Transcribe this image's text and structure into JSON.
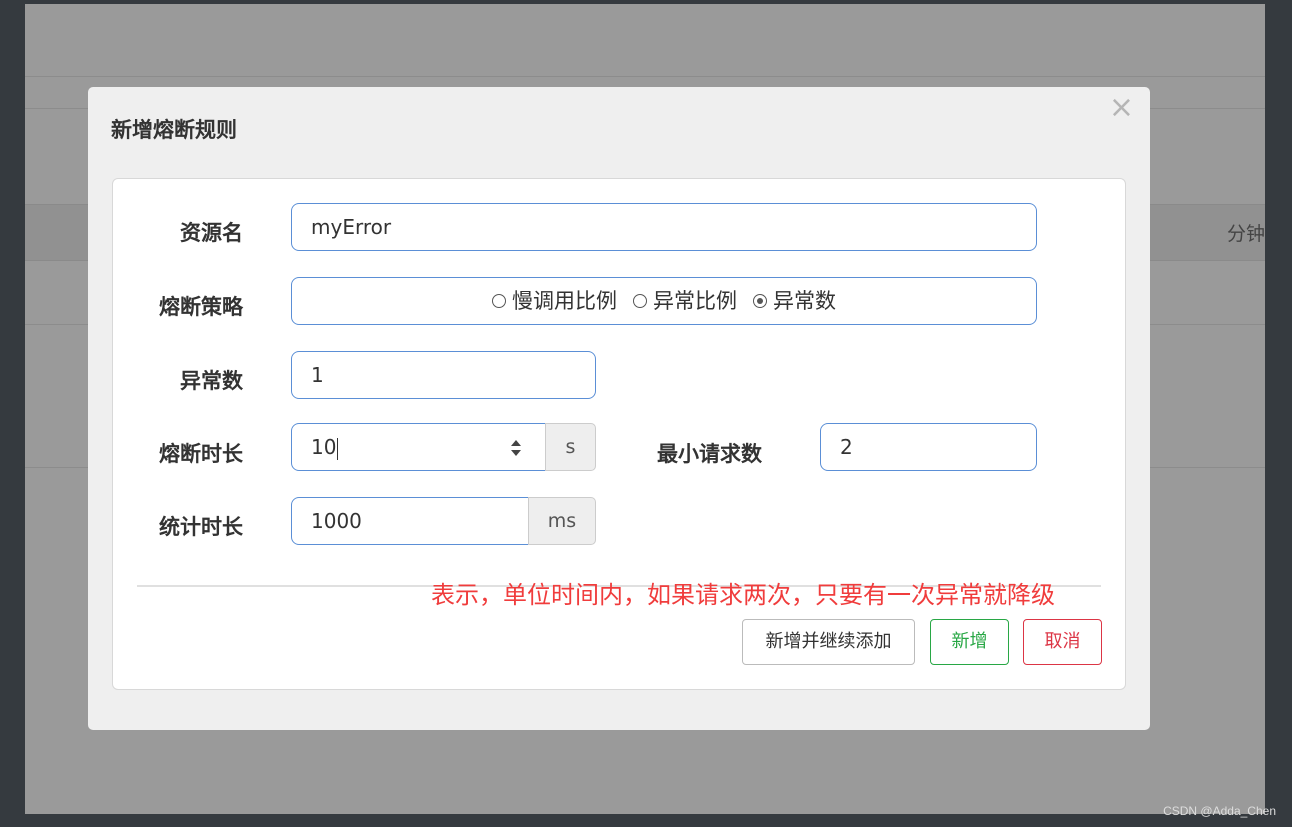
{
  "modal": {
    "title": "新增熔断规则",
    "close_glyph": "×"
  },
  "form": {
    "resource_label": "资源名",
    "resource_value": "myError",
    "strategy_label": "熔断策略",
    "strategy_options": [
      {
        "label": "慢调用比例",
        "selected": false
      },
      {
        "label": "异常比例",
        "selected": false
      },
      {
        "label": "异常数",
        "selected": true
      }
    ],
    "exception_count_label": "异常数",
    "exception_count_value": "1",
    "break_duration_label": "熔断时长",
    "break_duration_value": "10",
    "break_duration_unit": "s",
    "min_request_label": "最小请求数",
    "min_request_value": "2",
    "stat_duration_label": "统计时长",
    "stat_duration_value": "1000",
    "stat_duration_unit": "ms"
  },
  "annotation": "表示，单位时间内，如果请求两次，只要有一次异常就降级",
  "buttons": {
    "add_continue": "新增并继续添加",
    "add": "新增",
    "cancel": "取消"
  },
  "background": {
    "partial_text": "分钟"
  },
  "watermark": "CSDN @Adda_Chen",
  "colors": {
    "input_border": "#5b8fd6",
    "add_button": "#28a745",
    "cancel_button": "#dc3545",
    "annotation": "#f03c3c"
  }
}
